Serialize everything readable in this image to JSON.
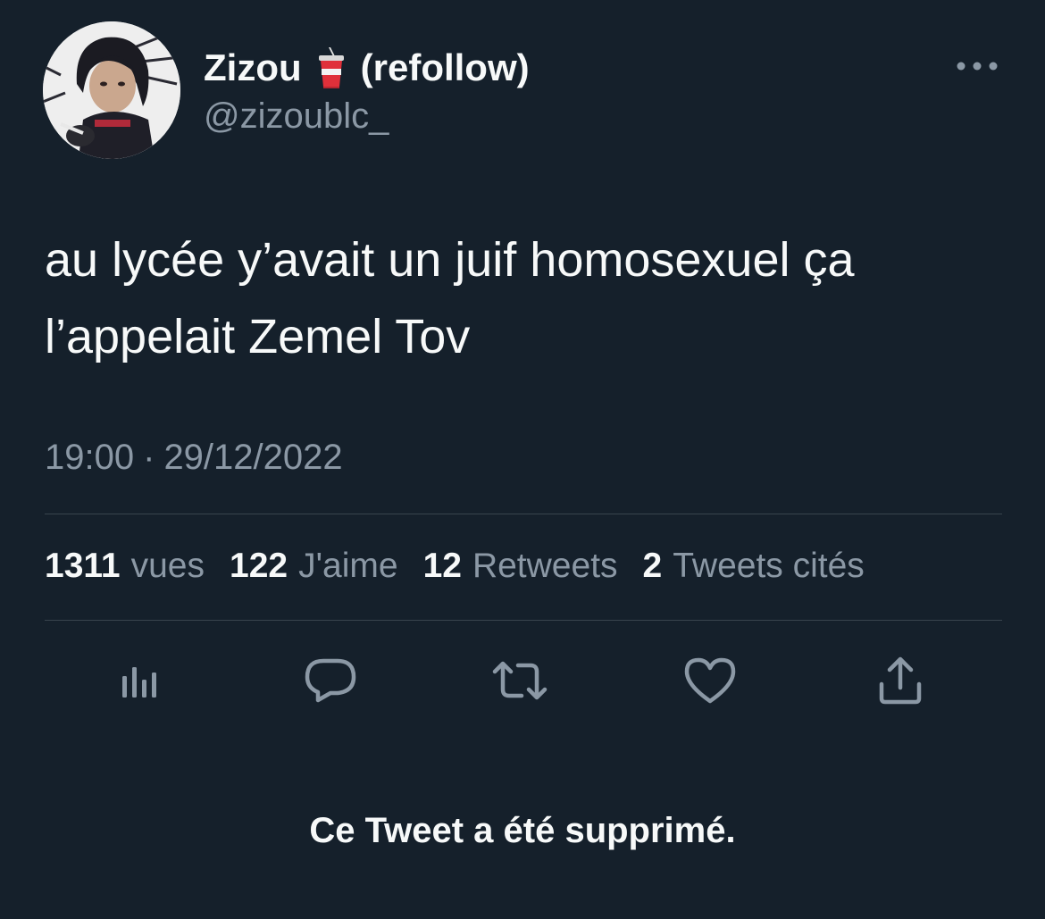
{
  "author": {
    "display_name": "Zizou",
    "name_emoji": "cup-with-straw-icon",
    "name_suffix": "(refollow)",
    "handle": "@zizoublc_"
  },
  "tweet": {
    "text": "au lycée y’avait un juif homosexuel ça\nl’appelait Zemel Tov",
    "time": "19:00",
    "separator": "·",
    "date": "29/12/2022"
  },
  "stats": [
    {
      "value": "1311",
      "label": "vues"
    },
    {
      "value": "122",
      "label": "J'aime"
    },
    {
      "value": "12",
      "label": "Retweets"
    },
    {
      "value": "2",
      "label": "Tweets cités"
    }
  ],
  "actions": [
    "analytics-icon",
    "reply-icon",
    "retweet-icon",
    "like-icon",
    "share-icon"
  ],
  "notice": "Ce Tweet a été supprimé.",
  "colors": {
    "background": "#15202b",
    "primary_text": "#f7f9f9",
    "secondary_text": "#8b98a5",
    "divider": "#38444d"
  }
}
